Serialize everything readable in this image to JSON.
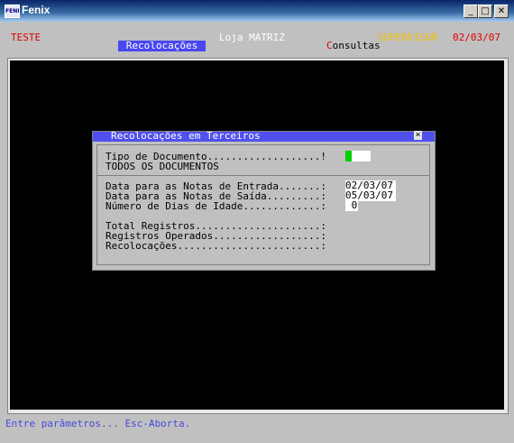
{
  "window": {
    "title": "Fenix",
    "icon_text": "FENIX",
    "buttons": {
      "minimize": "_",
      "maximize": "□",
      "close": "✕"
    }
  },
  "header": {
    "left_label": "TESTE",
    "store": "Loja MATRIZ",
    "user": "SUPERVISOR",
    "date": "02/03/07",
    "menu_active": "Recolocações",
    "menu_consultas_hotkey": "C",
    "menu_consultas_rest": "onsultas"
  },
  "dialog": {
    "title": "Recolocações em Terceiros",
    "close": "×",
    "tipo_label": "Tipo de Documento...................!",
    "tipo_desc": "TODOS OS DOCUMENTOS",
    "entrada_label": "Data para as Notas de Entrada.......:",
    "entrada_value": "02/03/07",
    "saida_label": "Data para as Notas de Saída.........:",
    "saida_value": "05/03/07",
    "dias_label": "Número de Dias de Idade.............:",
    "dias_value": " 0",
    "total_label": "Total Registros.....................:",
    "operados_label": "Registros Operados..................:",
    "recol_label": "Recolocações........................:"
  },
  "status_bar": "Entre parâmetros... Esc-Aborta.",
  "colors": {
    "accent_menu": "#4848f0",
    "warning_red": "#e00000",
    "supervisor": "#f0c000",
    "cursor_green": "#00d000"
  }
}
